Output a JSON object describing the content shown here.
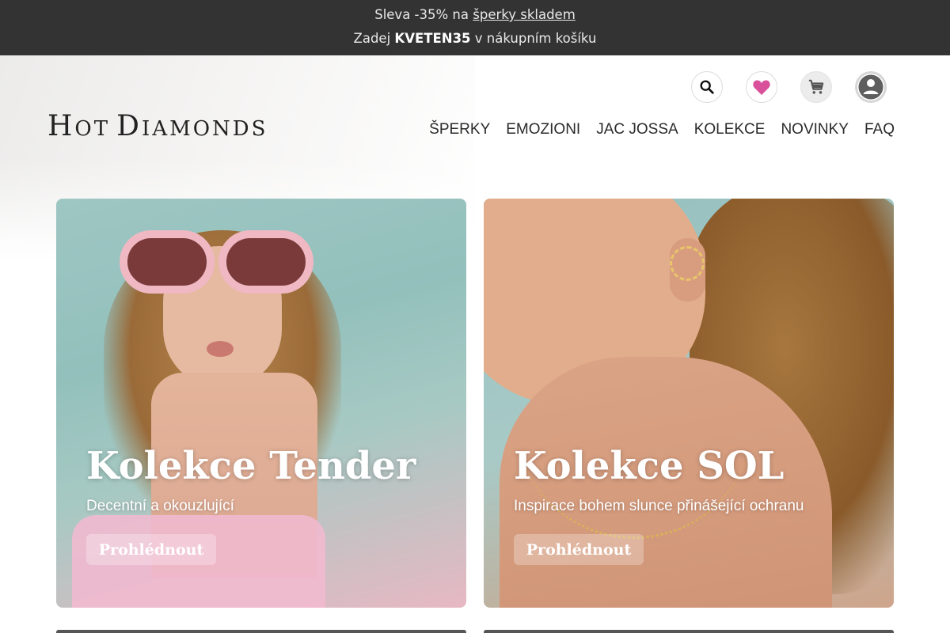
{
  "promo": {
    "line1_prefix": "Sleva -35% na ",
    "line1_link": "šperky skladem",
    "line2_prefix": "Zadej ",
    "line2_code": "KVETEN35",
    "line2_suffix": " v nákupním košíku"
  },
  "brand": {
    "logo_first_initial": "H",
    "logo_first_rest": "OT",
    "logo_second_initial": "D",
    "logo_second_rest": "IAMONDS"
  },
  "header_icons": [
    "search-icon",
    "heart-icon",
    "cart-icon",
    "user-icon"
  ],
  "nav": {
    "items": [
      "ŠPERKY",
      "EMOZIONI",
      "JAC JOSSA",
      "KOLEKCE",
      "NOVINKY",
      "FAQ"
    ]
  },
  "cards": [
    {
      "title": "Kolekce Tender",
      "subtitle": "Decentní a okouzlující",
      "button": "Prohlédnout"
    },
    {
      "title": "Kolekce SOL",
      "subtitle": "Inspirace bohem slunce přinášející ochranu",
      "button": "Prohlédnout"
    }
  ],
  "colors": {
    "promo_bg": "#333333",
    "heart": "#d9509b",
    "nav_text": "#2b2b2b"
  }
}
